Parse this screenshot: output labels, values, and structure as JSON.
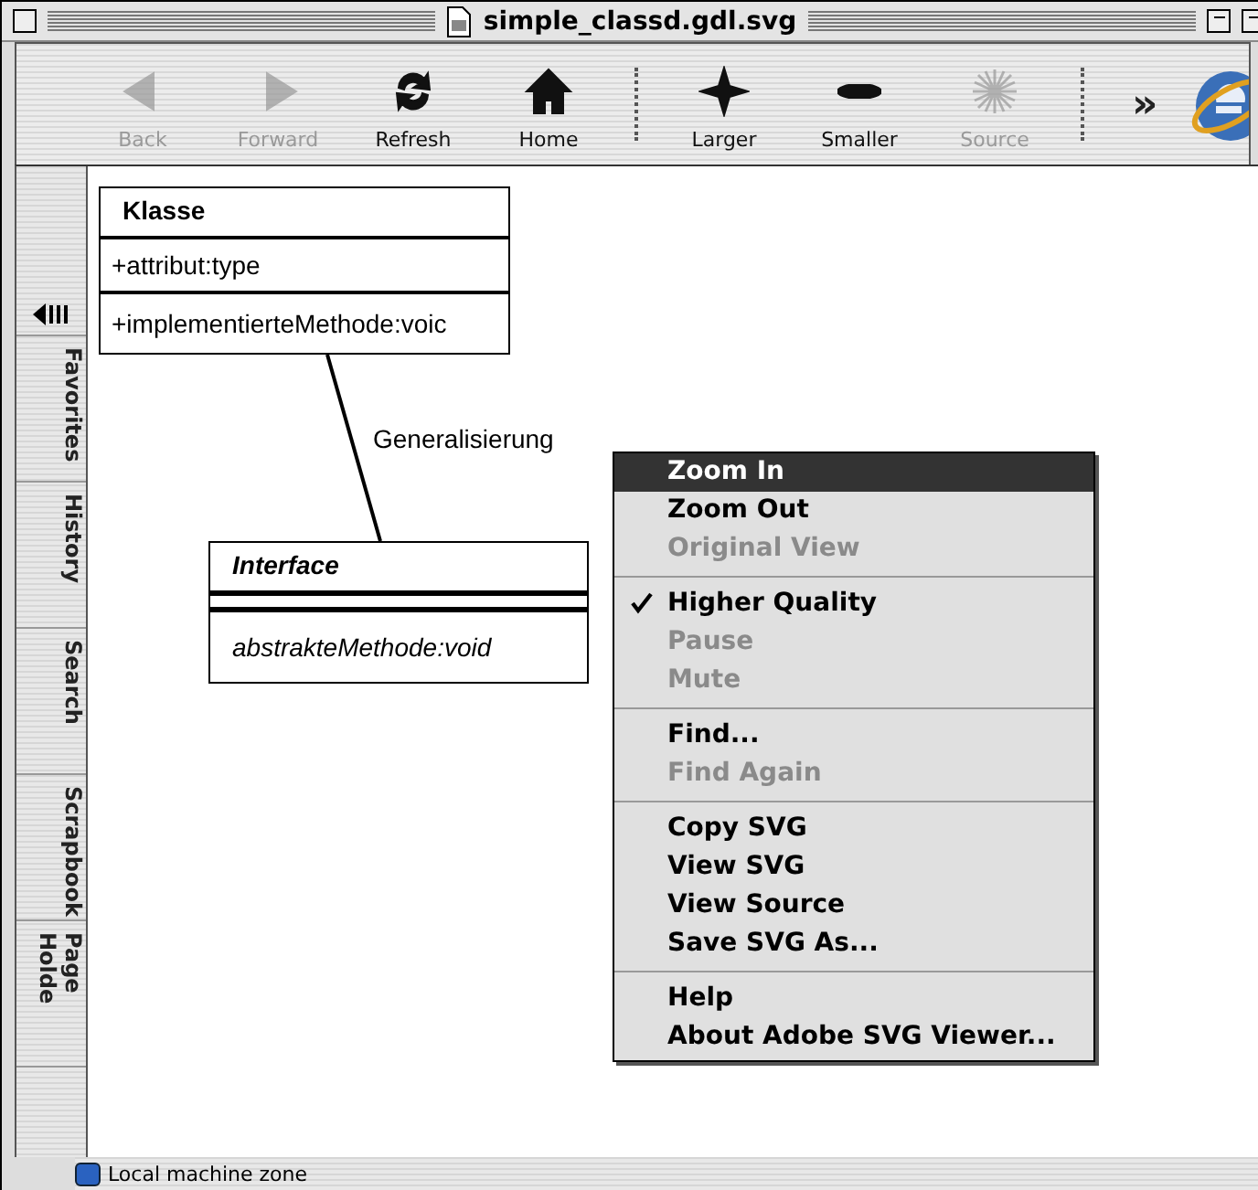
{
  "window": {
    "title": "simple_classd.gdl.svg"
  },
  "toolbar": {
    "buttons": [
      {
        "label": "Back",
        "kind": "back",
        "disabled": true
      },
      {
        "label": "Forward",
        "kind": "forward",
        "disabled": true
      },
      {
        "label": "Refresh",
        "kind": "refresh",
        "disabled": false
      },
      {
        "label": "Home",
        "kind": "home",
        "disabled": false
      },
      {
        "kind": "separator"
      },
      {
        "label": "Larger",
        "kind": "larger",
        "disabled": false
      },
      {
        "label": "Smaller",
        "kind": "smaller",
        "disabled": false
      },
      {
        "label": "Source",
        "kind": "source",
        "disabled": true
      },
      {
        "kind": "separator"
      },
      {
        "label": "»",
        "kind": "more"
      }
    ]
  },
  "sidebar": {
    "tabs": [
      {
        "label": "Favorites"
      },
      {
        "label": "History"
      },
      {
        "label": "Search"
      },
      {
        "label": "Scrapbook"
      },
      {
        "label": "Page Holde"
      }
    ]
  },
  "diagram": {
    "classes": [
      {
        "name": "Klasse",
        "abstract": false,
        "attributes": [
          "+attribut:type"
        ],
        "methods": [
          "+implementierteMethode:voic"
        ]
      },
      {
        "name": "Interface",
        "abstract": true,
        "methods": [
          "abstrakteMethode:void"
        ]
      }
    ],
    "relation": {
      "label": "Generalisierung"
    }
  },
  "context_menu": {
    "groups": [
      {
        "items": [
          {
            "label": "Zoom In",
            "selected": true,
            "disabled": false,
            "checked": false
          },
          {
            "label": "Zoom Out",
            "selected": false,
            "disabled": false,
            "checked": false
          },
          {
            "label": "Original View",
            "selected": false,
            "disabled": true,
            "checked": false
          }
        ]
      },
      {
        "items": [
          {
            "label": "Higher Quality",
            "selected": false,
            "disabled": false,
            "checked": true
          },
          {
            "label": "Pause",
            "selected": false,
            "disabled": true,
            "checked": false
          },
          {
            "label": "Mute",
            "selected": false,
            "disabled": true,
            "checked": false
          }
        ]
      },
      {
        "items": [
          {
            "label": "Find...",
            "selected": false,
            "disabled": false,
            "checked": false
          },
          {
            "label": "Find Again",
            "selected": false,
            "disabled": true,
            "checked": false
          }
        ]
      },
      {
        "items": [
          {
            "label": "Copy SVG",
            "selected": false,
            "disabled": false,
            "checked": false
          },
          {
            "label": "View SVG",
            "selected": false,
            "disabled": false,
            "checked": false
          },
          {
            "label": "View Source",
            "selected": false,
            "disabled": false,
            "checked": false
          },
          {
            "label": "Save SVG As...",
            "selected": false,
            "disabled": false,
            "checked": false
          }
        ]
      },
      {
        "items": [
          {
            "label": "Help",
            "selected": false,
            "disabled": false,
            "checked": false
          },
          {
            "label": "About Adobe SVG Viewer...",
            "selected": false,
            "disabled": false,
            "checked": false
          }
        ]
      }
    ]
  },
  "status_bar": {
    "text": "Local machine zone"
  }
}
